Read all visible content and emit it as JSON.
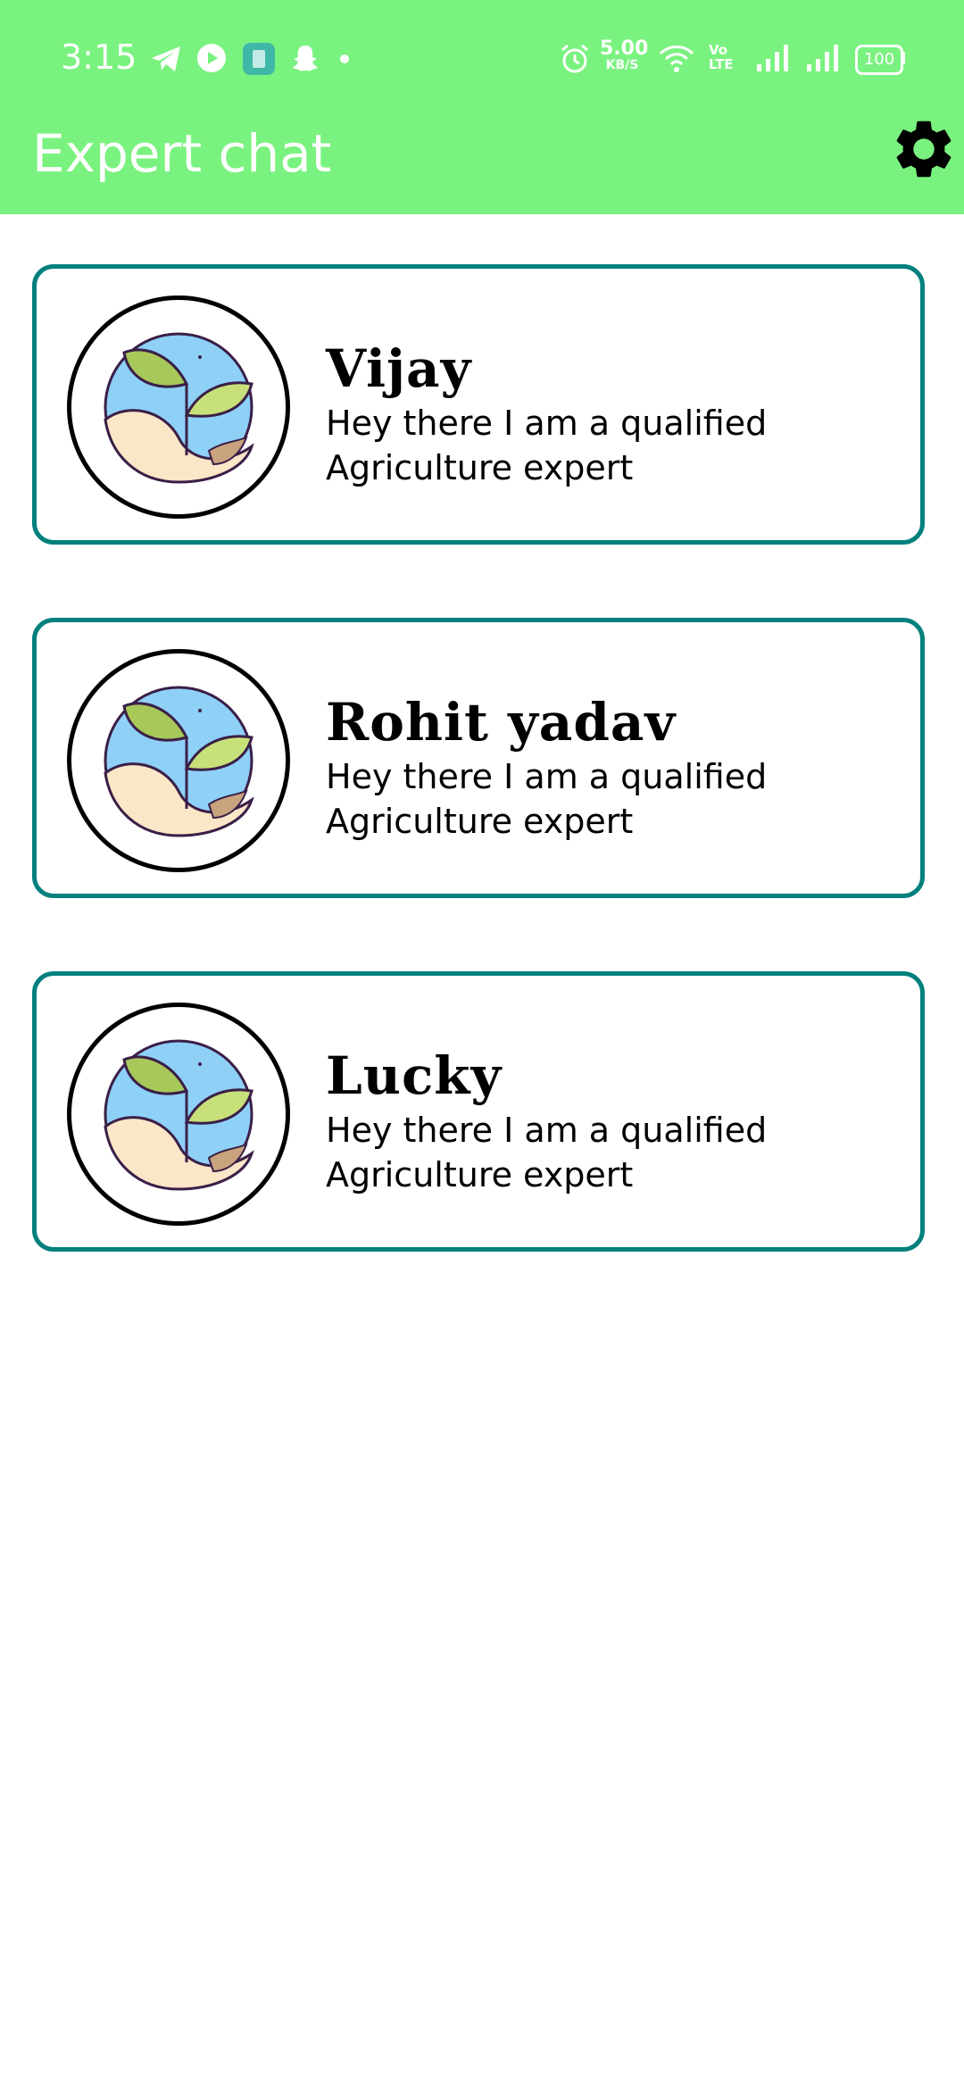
{
  "status_bar": {
    "time": "3:15",
    "net_speed": "5.00",
    "net_unit": "KB/S",
    "volte": "Vo LTE",
    "battery": "100",
    "icons": [
      "telegram-icon",
      "youtube-icon",
      "app-icon",
      "snapchat-icon",
      "dot-icon",
      "alarm-icon",
      "wifi-icon",
      "signal-icon",
      "signal-icon",
      "battery-icon"
    ]
  },
  "appbar": {
    "title": "Expert chat",
    "settings_icon": "gear-icon"
  },
  "experts": [
    {
      "name": "Vijay",
      "message": "Hey there I am a qualified Agriculture expert"
    },
    {
      "name": "Rohit yadav",
      "message": "Hey there I am a qualified Agriculture expert"
    },
    {
      "name": "Lucky",
      "message": "Hey there I am a qualified Agriculture expert"
    }
  ],
  "colors": {
    "appbar": "#7af27f",
    "card_border": "#00807d",
    "text": "#000000"
  }
}
